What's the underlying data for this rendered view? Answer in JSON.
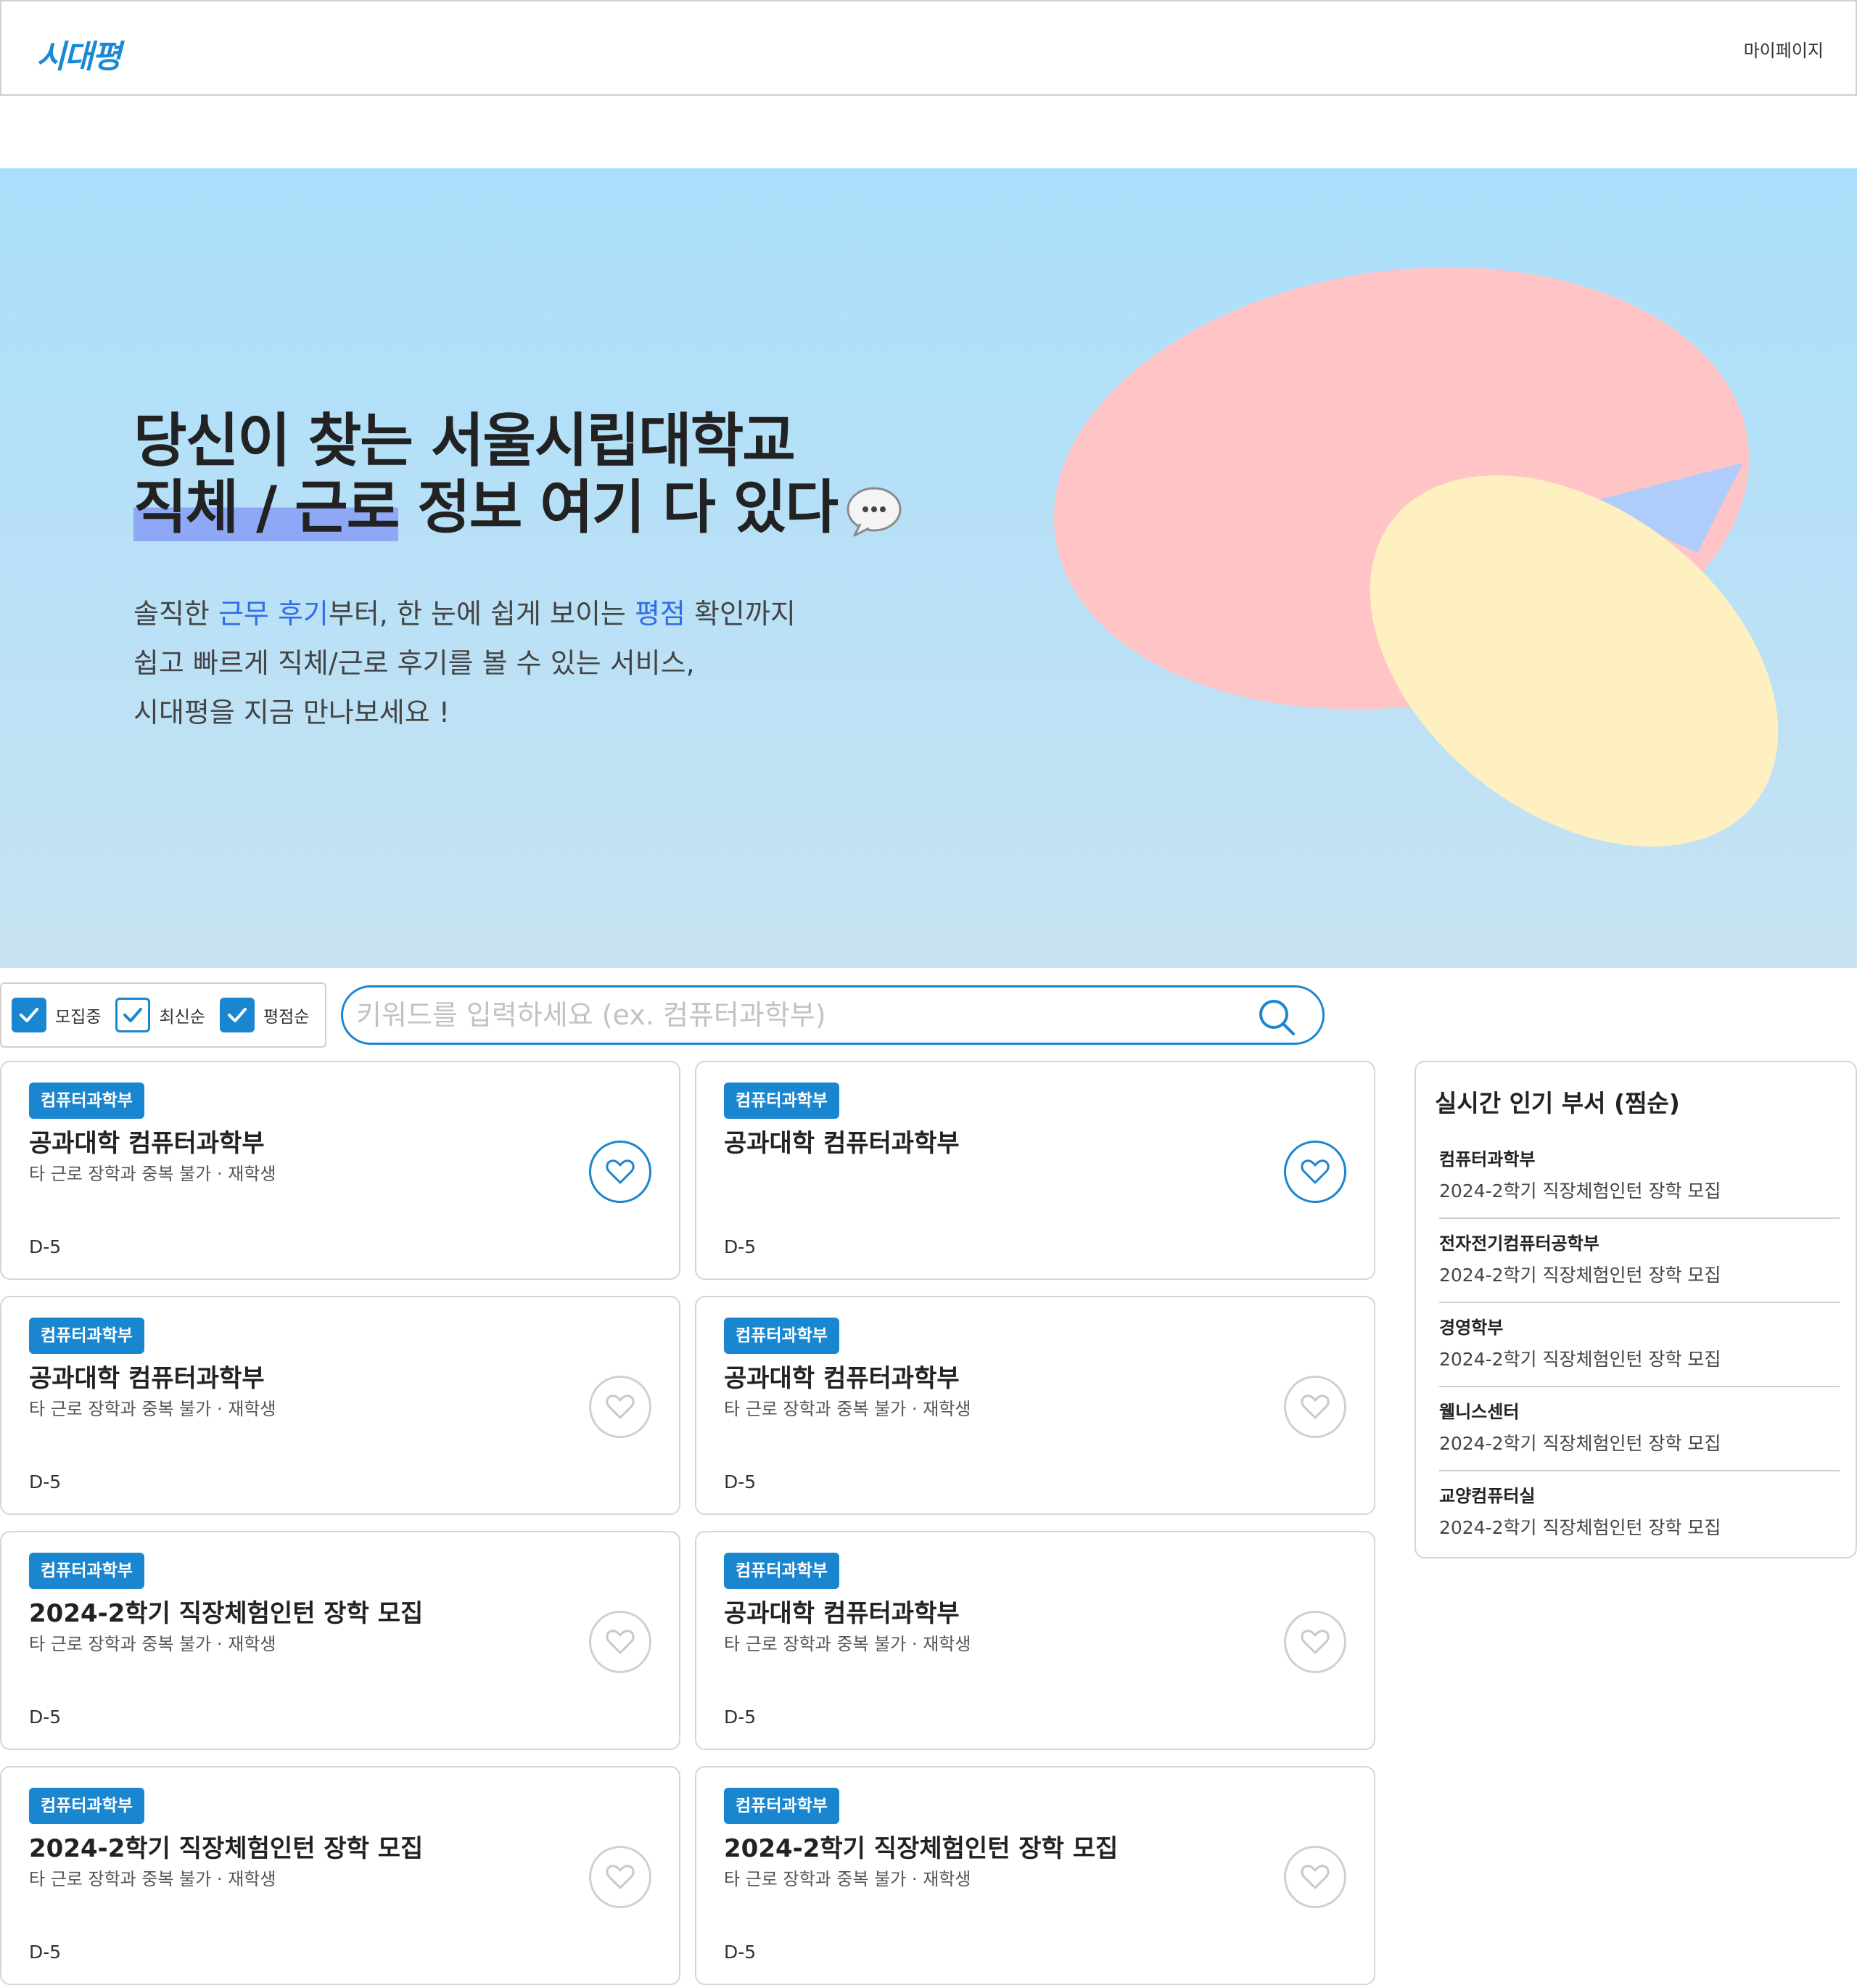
{
  "header": {
    "logo": "시대평",
    "mypage_label": "마이페이지"
  },
  "hero": {
    "title_line1": "당신이 찾는 서울시립대학교",
    "title_line2_highlight": "직체 / 근로",
    "title_line2_rest": " 정보 여기 다 있다",
    "desc1_a": "솔직한 ",
    "desc1_b": "근무 후기",
    "desc1_c": "부터, 한 눈에 쉽게 보이는 ",
    "desc1_d": "평점",
    "desc1_e": " 확인까지",
    "desc2": "쉽고 빠르게 직체/근로 후기를 볼 수 있는 서비스,",
    "desc3": "시대평을 지금 만나보세요 !",
    "icon": "speech-bubble-icon"
  },
  "filters": [
    {
      "label": "모집중",
      "checked": true
    },
    {
      "label": "최신순",
      "checked": false
    },
    {
      "label": "평점순",
      "checked": true
    }
  ],
  "search": {
    "placeholder": "키워드를 입력하세요 (ex. 컴퓨터과학부)",
    "value": "",
    "icon": "search-icon"
  },
  "cards": [
    {
      "badge": "컴퓨터과학부",
      "title": "공과대학 컴퓨터과학부",
      "subtitle": "타 근로 장학과 중복 불가 · 재학생",
      "dday": "D-5",
      "liked": true
    },
    {
      "badge": "컴퓨터과학부",
      "title": "공과대학 컴퓨터과학부",
      "subtitle": "",
      "dday": "D-5",
      "liked": true
    },
    {
      "badge": "컴퓨터과학부",
      "title": "공과대학 컴퓨터과학부",
      "subtitle": "타 근로 장학과 중복 불가 · 재학생",
      "dday": "D-5",
      "liked": false
    },
    {
      "badge": "컴퓨터과학부",
      "title": "공과대학 컴퓨터과학부",
      "subtitle": "타 근로 장학과 중복 불가 · 재학생",
      "dday": "D-5",
      "liked": false
    },
    {
      "badge": "컴퓨터과학부",
      "title": "2024-2학기 직장체험인턴 장학 모집",
      "subtitle": "타 근로 장학과 중복 불가 · 재학생",
      "dday": "D-5",
      "liked": false
    },
    {
      "badge": "컴퓨터과학부",
      "title": "공과대학 컴퓨터과학부",
      "subtitle": "타 근로 장학과 중복 불가 · 재학생",
      "dday": "D-5",
      "liked": false
    },
    {
      "badge": "컴퓨터과학부",
      "title": "2024-2학기 직장체험인턴 장학 모집",
      "subtitle": "타 근로 장학과 중복 불가 · 재학생",
      "dday": "D-5",
      "liked": false
    },
    {
      "badge": "컴퓨터과학부",
      "title": "2024-2학기 직장체험인턴 장학 모집",
      "subtitle": "타 근로 장학과 중복 불가 · 재학생",
      "dday": "D-5",
      "liked": false
    }
  ],
  "sidebar": {
    "title": "실시간 인기 부서 (찜순)",
    "items": [
      {
        "name": "컴퓨터과학부",
        "desc": "2024-2학기 직장체험인턴 장학 모집"
      },
      {
        "name": "전자전기컴퓨터공학부",
        "desc": "2024-2학기 직장체험인턴 장학 모집"
      },
      {
        "name": "경영학부",
        "desc": "2024-2학기 직장체험인턴 장학 모집"
      },
      {
        "name": "웰니스센터",
        "desc": "2024-2학기 직장체험인턴 장학 모집"
      },
      {
        "name": "교양컴퓨터실",
        "desc": "2024-2학기 직장체험인턴 장학 모집"
      }
    ]
  },
  "colors": {
    "accent": "#1a86d0",
    "hero_bg_top": "#aadffb",
    "hero_bg_bottom": "#c7e2f2",
    "highlight": "#8fa8f5",
    "blob_pink": "#ffc4c6",
    "blob_yellow": "#fff0c2",
    "blob_blue": "#b0ccfa"
  }
}
